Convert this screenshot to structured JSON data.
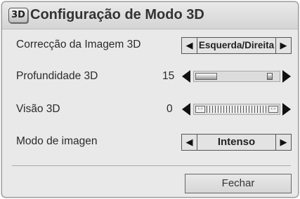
{
  "dialog": {
    "badge": "3D",
    "title": "Configuração de Modo 3D"
  },
  "rows": {
    "correction": {
      "label": "Correcção da Imagem 3D",
      "value": "Esquerda/Direita"
    },
    "depth": {
      "label": "Profundidade 3D",
      "value": "15",
      "level": 0.13
    },
    "vision": {
      "label": "Visão 3D",
      "value": "0"
    },
    "picture_mode": {
      "label": "Modo de imagen",
      "value": "Intenso"
    }
  },
  "buttons": {
    "close": "Fechar"
  },
  "icons": {
    "left": "arrow-left-icon",
    "right": "arrow-right-icon",
    "badge": "3d-mode-icon"
  }
}
